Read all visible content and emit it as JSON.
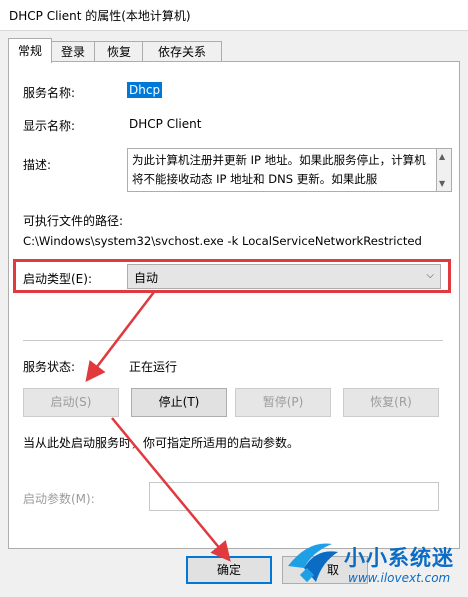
{
  "window": {
    "title": "DHCP Client 的属性(本地计算机)"
  },
  "tabs": [
    {
      "label": "常规",
      "active": true
    },
    {
      "label": "登录",
      "active": false
    },
    {
      "label": "恢复",
      "active": false
    },
    {
      "label": "依存关系",
      "active": false
    }
  ],
  "general": {
    "service_name_label": "服务名称:",
    "service_name_value": "Dhcp",
    "display_name_label": "显示名称:",
    "display_name_value": "DHCP Client",
    "description_label": "描述:",
    "description_value": "为此计算机注册并更新 IP 地址。如果此服务停止，计算机将不能接收动态 IP 地址和 DNS 更新。如果此服",
    "exe_path_label": "可执行文件的路径:",
    "exe_path_value": "C:\\Windows\\system32\\svchost.exe -k LocalServiceNetworkRestricted",
    "startup_type_label": "启动类型(E):",
    "startup_type_value": "自动",
    "service_status_label": "服务状态:",
    "service_status_value": "正在运行",
    "buttons": {
      "start": "启动(S)",
      "stop": "停止(T)",
      "pause": "暂停(P)",
      "resume": "恢复(R)"
    },
    "hint": "当从此处启动服务时，你可指定所适用的启动参数。",
    "start_params_label": "启动参数(M):",
    "start_params_value": ""
  },
  "footer": {
    "ok": "确定",
    "cancel": "取"
  },
  "watermark": {
    "text": "小小系统迷",
    "url": "www.ilovext.com"
  },
  "colors": {
    "annotation": "#e0393e",
    "accent": "#0078d7",
    "watermark": "#0a6cc4"
  }
}
